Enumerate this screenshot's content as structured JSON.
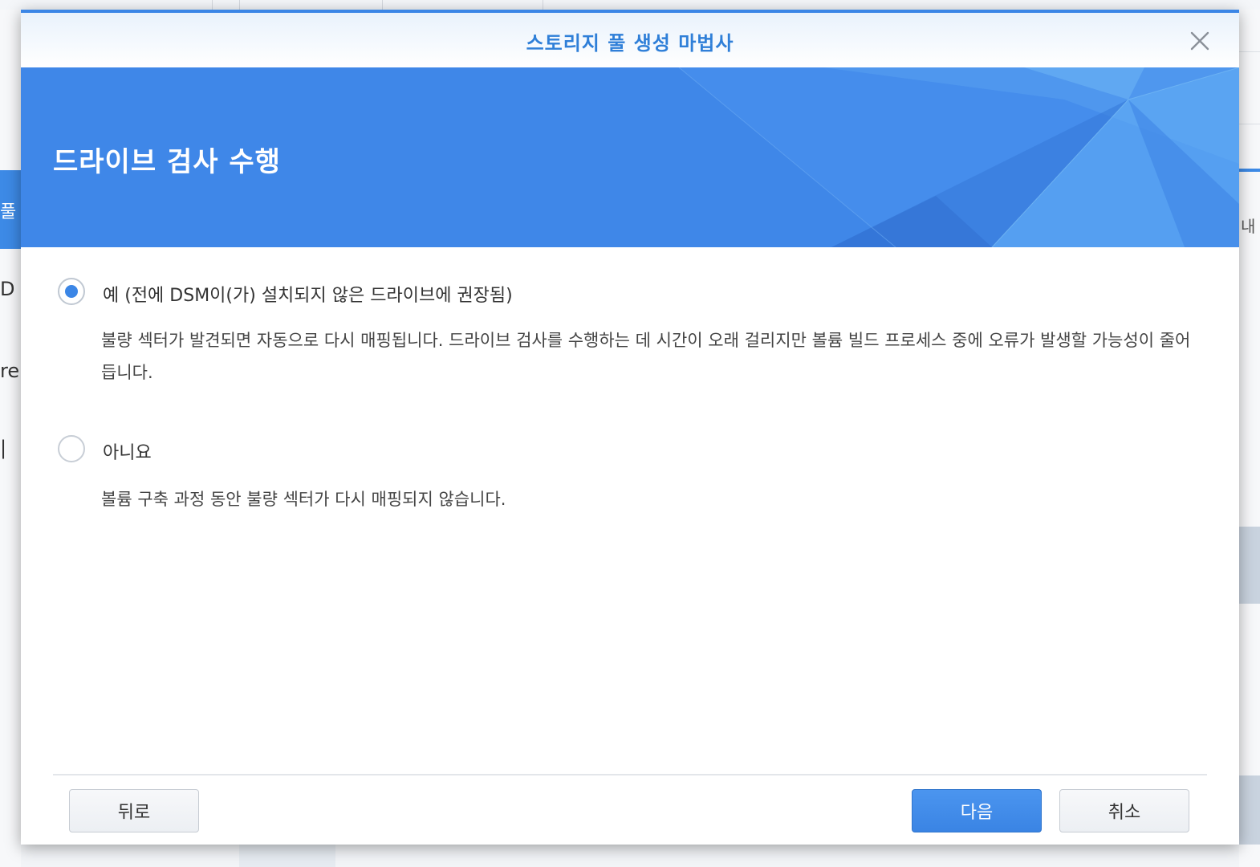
{
  "background": {
    "sidebar_fragments": [
      "D",
      "re",
      "|"
    ],
    "sidebar_active": "풀",
    "right_fragment": "내 ",
    "colors": {
      "accent": "#3d8ae6"
    }
  },
  "dialog": {
    "title": "스토리지 풀 생성 마법사",
    "banner_title": "드라이브 검사 수행",
    "options": [
      {
        "label": "예 (전에 DSM이(가) 설치되지 않은 드라이브에 권장됨)",
        "description": "불량 섹터가 발견되면 자동으로 다시 매핑됩니다. 드라이브 검사를 수행하는 데 시간이 오래 걸리지만 볼륨 빌드 프로세스 중에 오류가 발생할 가능성이 줄어듭니다.",
        "checked": true
      },
      {
        "label": "아니요",
        "description": "볼륨 구축 과정 동안 불량 섹터가 다시 매핑되지 않습니다.",
        "checked": false
      }
    ],
    "buttons": {
      "back": "뒤로",
      "next": "다음",
      "cancel": "취소"
    },
    "icons": {
      "close": "close-icon"
    },
    "colors": {
      "accent": "#3b86e6",
      "banner": "#3f87e8",
      "title": "#2f7fd8"
    }
  }
}
